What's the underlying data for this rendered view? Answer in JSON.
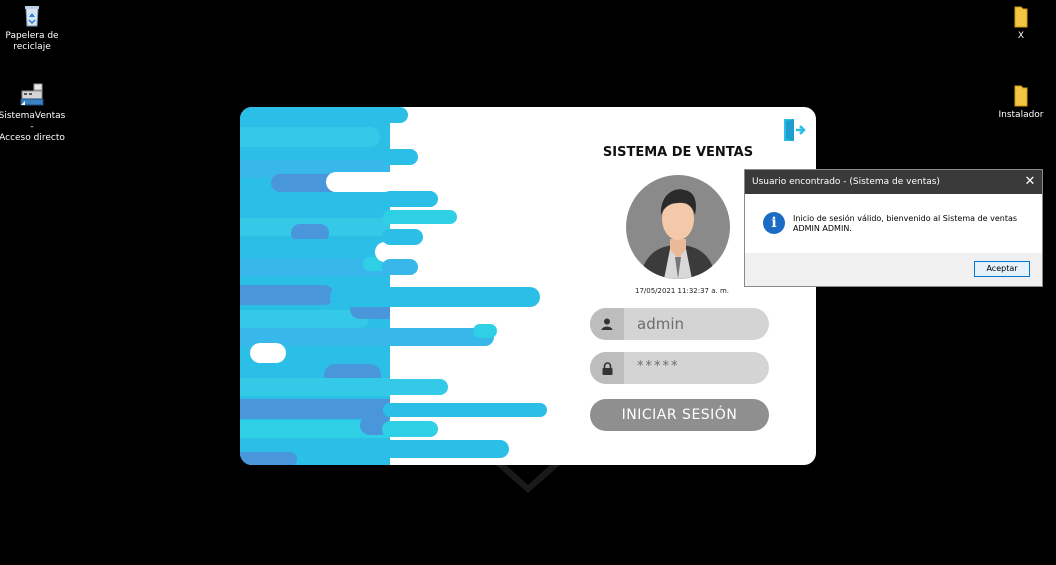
{
  "desktop": {
    "icons": [
      {
        "label": "Papelera de\nreciclaje",
        "icon": "recycle-bin-icon"
      },
      {
        "label": "SistemaVentas -\nAcceso directo",
        "icon": "cash-register-icon"
      },
      {
        "label": "X",
        "icon": "folder-icon"
      },
      {
        "label": "Instalador",
        "icon": "folder-icon"
      }
    ]
  },
  "login": {
    "title": "SISTEMA DE VENTAS",
    "datetime": "17/05/2021 11:32:37 a. m.",
    "username_value": "admin",
    "password_value": "*****",
    "login_button": "INICIAR SESIÓN"
  },
  "dialog": {
    "title": "Usuario encontrado - (Sistema de ventas)",
    "message_line1": "Inicio de sesión válido, bienvenido al Sistema de ventas",
    "message_line2": "ADMIN ADMIN.",
    "ok_button": "Aceptar",
    "close_symbol": "✕"
  },
  "colors": {
    "accent_cyan": "#2bbfe8",
    "accent_blue": "#4d8fd8",
    "info_blue": "#1a6cc4"
  }
}
